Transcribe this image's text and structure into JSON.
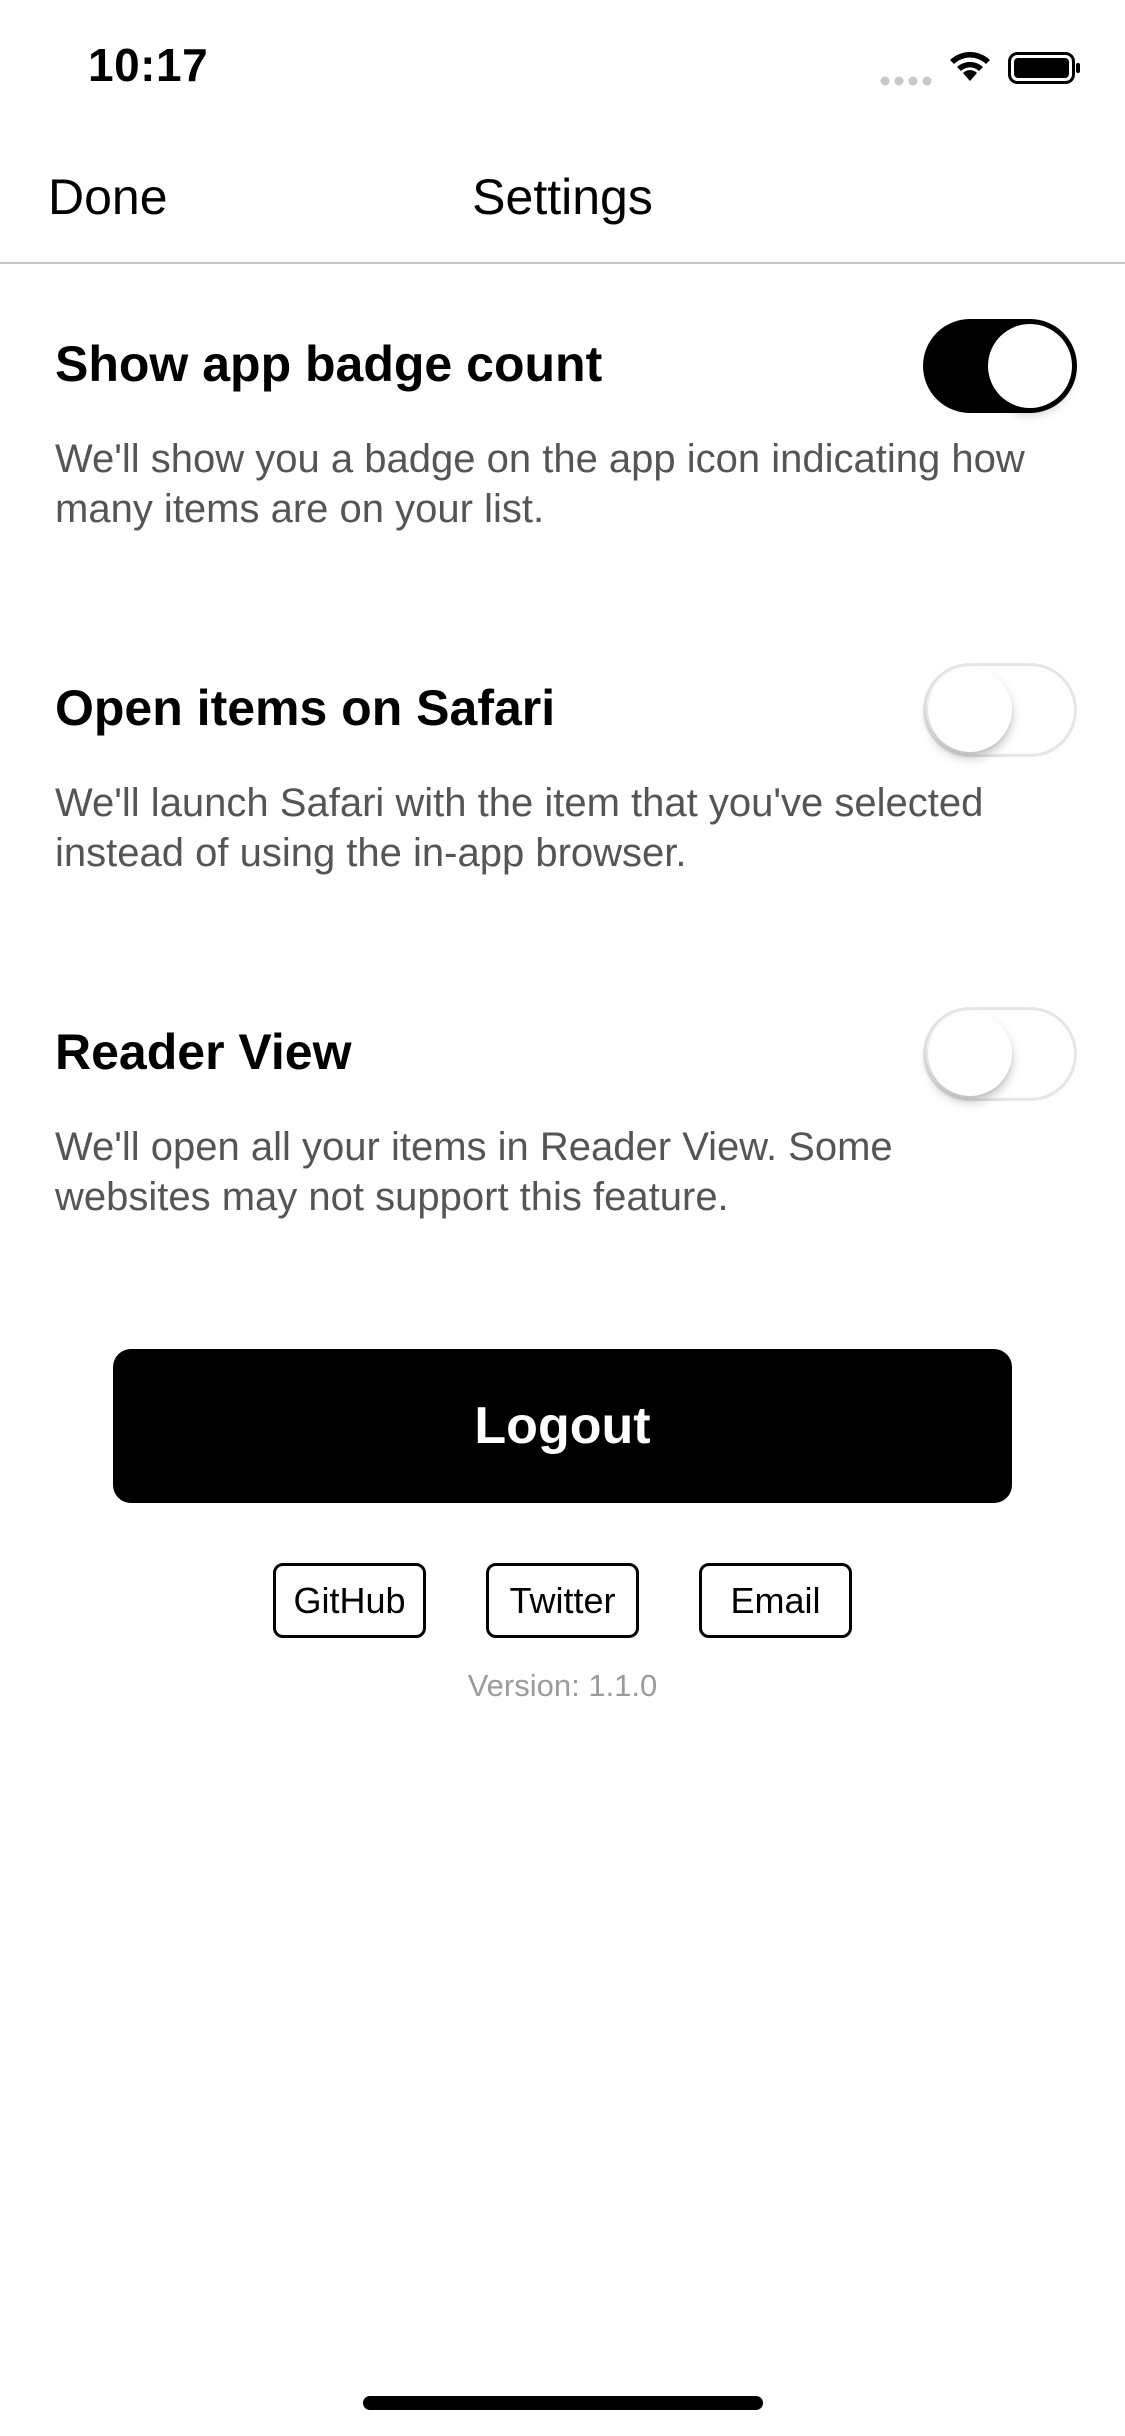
{
  "status_bar": {
    "time": "10:17",
    "icons": [
      "signal-dots-icon",
      "wifi-icon",
      "battery-icon"
    ]
  },
  "nav": {
    "done_label": "Done",
    "title": "Settings"
  },
  "settings": [
    {
      "title": "Show app badge count",
      "description": "We'll show you a badge on the app icon indicating how many items are on your list.",
      "enabled": true
    },
    {
      "title": "Open items on Safari",
      "description": "We'll launch Safari with the item that you've selected instead of using the in-app browser.",
      "enabled": false
    },
    {
      "title": "Reader View",
      "description": "We'll open all your items in Reader View. Some websites may not support this feature.",
      "enabled": false
    }
  ],
  "actions": {
    "logout_label": "Logout"
  },
  "links": {
    "github_label": "GitHub",
    "twitter_label": "Twitter",
    "email_label": "Email"
  },
  "footer": {
    "version_text": "Version: 1.1.0"
  },
  "colors": {
    "accent": "#000000",
    "description_text": "#555555",
    "version_text": "#9b9b9b",
    "toggle_off_border": "#e5e5ea",
    "divider": "#c8c8cc"
  }
}
